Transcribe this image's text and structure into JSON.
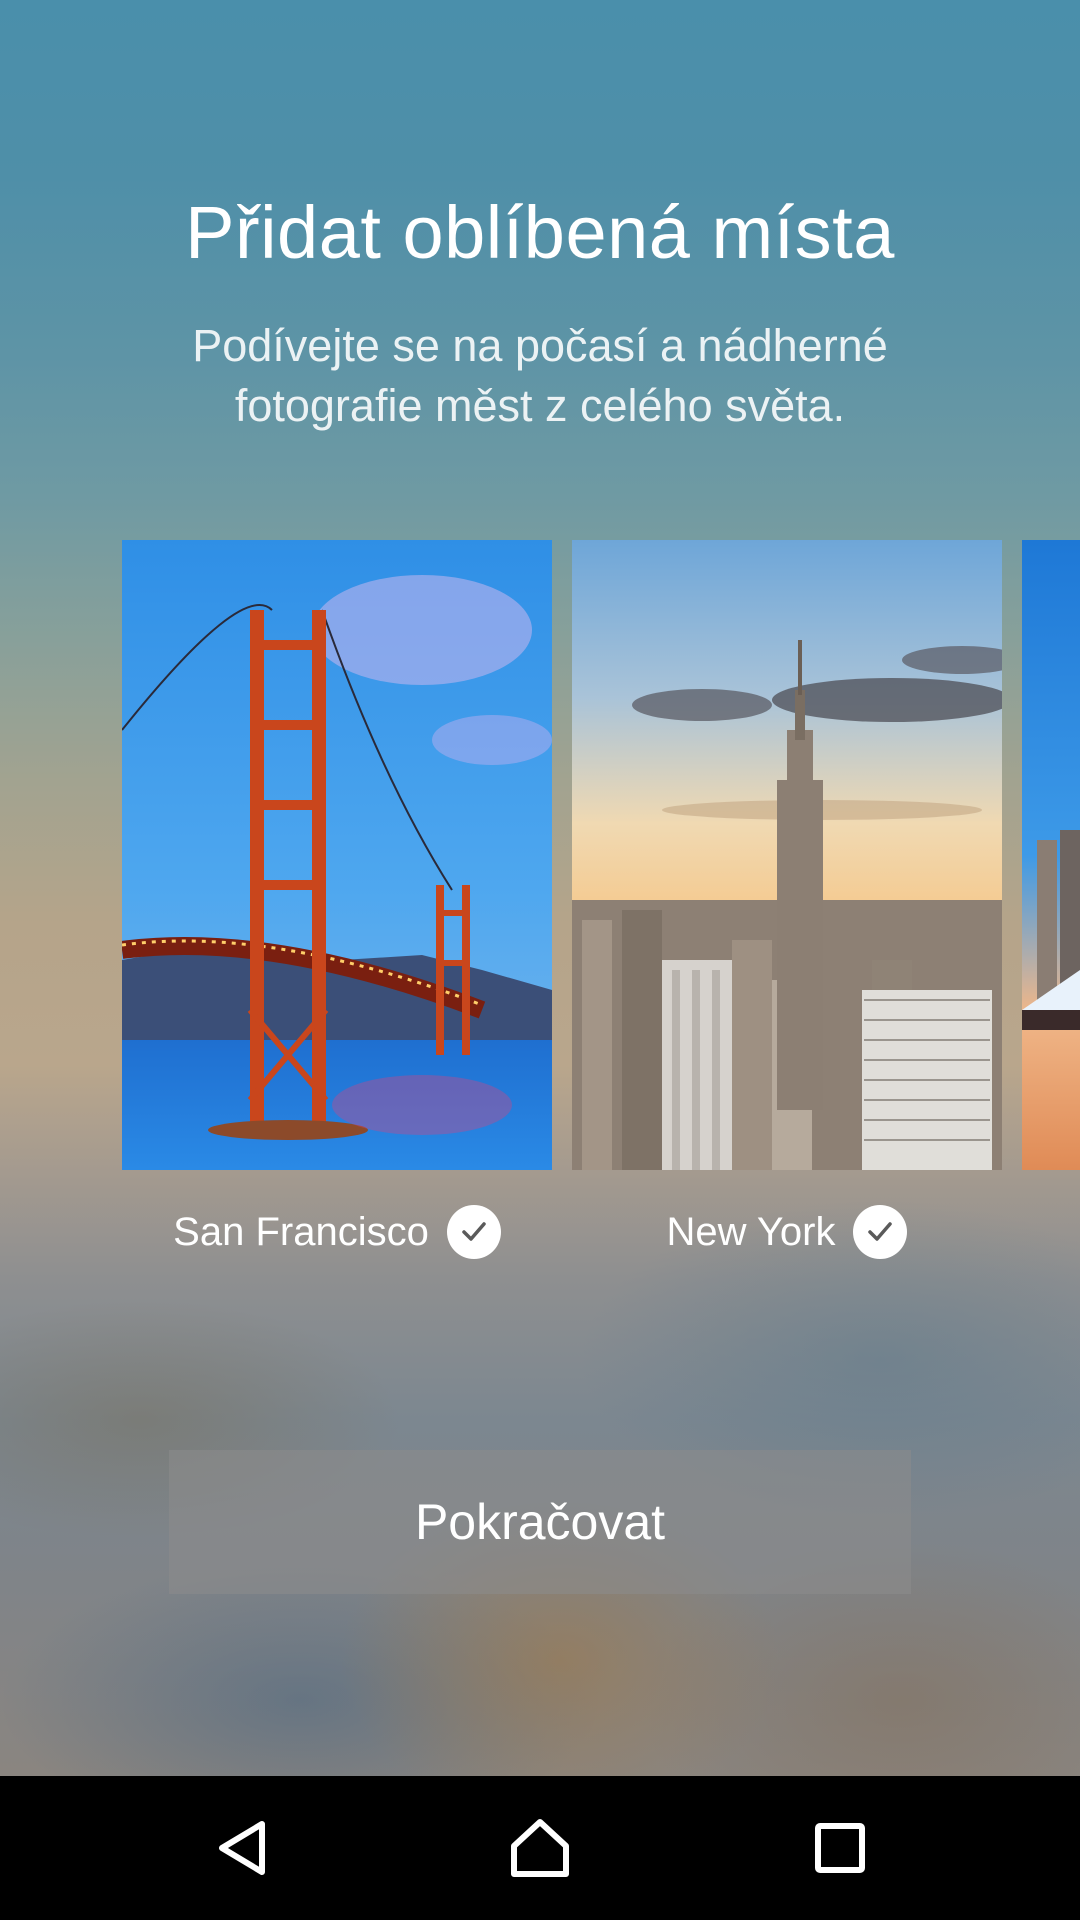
{
  "header": {
    "title": "Přidat oblíbená místa",
    "subtitle": "Podívejte se na počasí a nádherné fotografie měst z celého světa."
  },
  "cities": [
    {
      "name": "San Francisco",
      "selected": true,
      "image": "golden-gate-bridge-photo"
    },
    {
      "name": "New York",
      "selected": true,
      "image": "empire-state-building-photo"
    },
    {
      "name": "",
      "selected": false,
      "image": "city-skyline-photo-partial"
    }
  ],
  "actions": {
    "continue_label": "Pokračovat"
  },
  "navbar": {
    "back_icon": "back-triangle-icon",
    "home_icon": "home-icon",
    "recents_icon": "recents-square-icon"
  },
  "colors": {
    "text": "#ffffff",
    "button_bg": "#8c8c8c",
    "navbar_bg": "#000000"
  }
}
